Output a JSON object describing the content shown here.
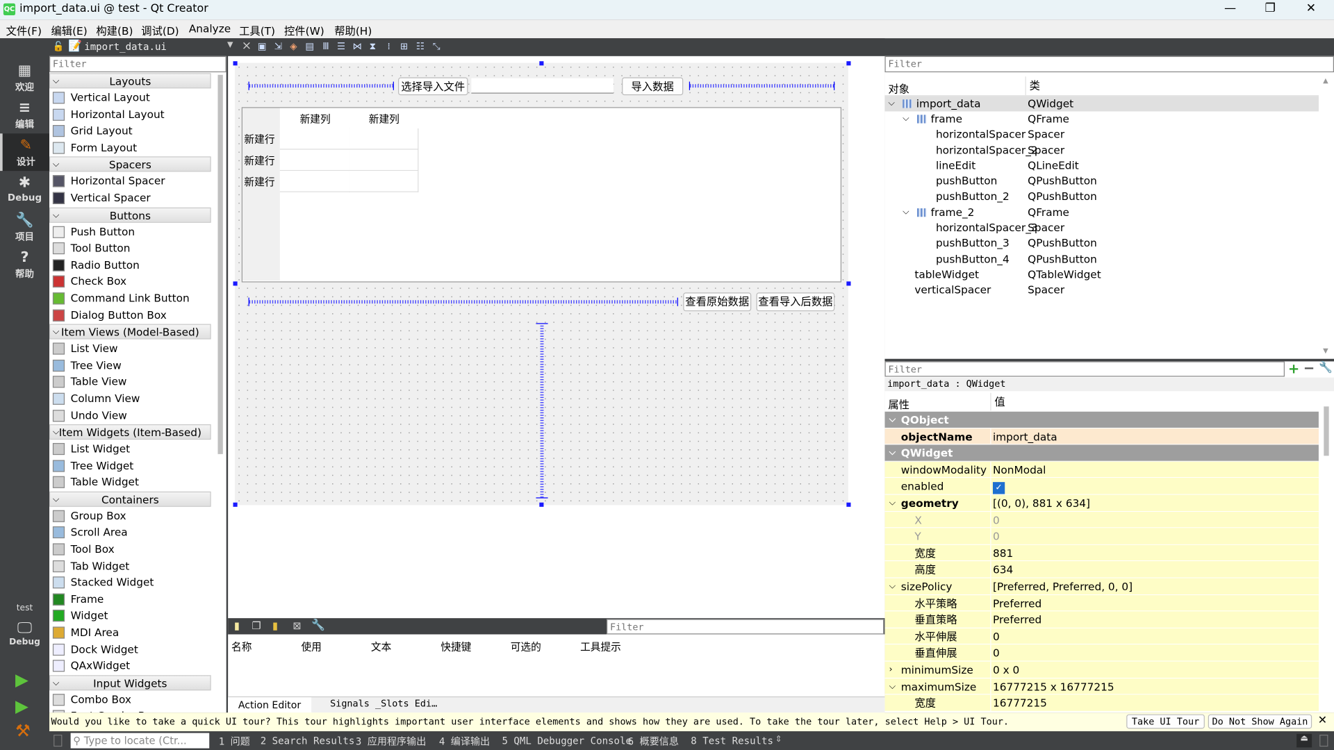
{
  "window": {
    "title": "import_data.ui @ test - Qt Creator",
    "logo": "QC",
    "minimize": "—",
    "maximize": "❐",
    "close": "✕"
  },
  "menu": [
    "文件(F)",
    "编辑(E)",
    "构建(B)",
    "调试(D)",
    "Analyze",
    "工具(T)",
    "控件(W)",
    "帮助(H)"
  ],
  "modes": [
    {
      "label": "欢迎",
      "icon": "grid-icon",
      "glyph": "▦"
    },
    {
      "label": "编辑",
      "icon": "document-icon",
      "glyph": "≡"
    },
    {
      "label": "设计",
      "icon": "pencil-icon",
      "glyph": "✎",
      "active": true
    },
    {
      "label": "Debug",
      "icon": "bug-icon",
      "glyph": "✱"
    },
    {
      "label": "项目",
      "icon": "wrench-icon",
      "glyph": "🔧"
    },
    {
      "label": "帮助",
      "icon": "help-icon",
      "glyph": "?"
    }
  ],
  "kit": {
    "project": "test",
    "mode": "Debug"
  },
  "editor": {
    "file": "import_data.ui",
    "close": "×"
  },
  "widgetbox": {
    "filter_placeholder": "Filter",
    "groups": [
      {
        "name": "Layouts",
        "items": [
          "Vertical Layout",
          "Horizontal Layout",
          "Grid Layout",
          "Form Layout"
        ]
      },
      {
        "name": "Spacers",
        "items": [
          "Horizontal Spacer",
          "Vertical Spacer"
        ]
      },
      {
        "name": "Buttons",
        "items": [
          "Push Button",
          "Tool Button",
          "Radio Button",
          "Check Box",
          "Command Link Button",
          "Dialog Button Box"
        ]
      },
      {
        "name": "Item Views (Model-Based)",
        "items": [
          "List View",
          "Tree View",
          "Table View",
          "Column View",
          "Undo View"
        ]
      },
      {
        "name": "Item Widgets (Item-Based)",
        "items": [
          "List Widget",
          "Tree Widget",
          "Table Widget"
        ]
      },
      {
        "name": "Containers",
        "items": [
          "Group Box",
          "Scroll Area",
          "Tool Box",
          "Tab Widget",
          "Stacked Widget",
          "Frame",
          "Widget",
          "MDI Area",
          "Dock Widget",
          "QAxWidget"
        ]
      },
      {
        "name": "Input Widgets",
        "items": [
          "Combo Box",
          "Font Combo Box"
        ]
      }
    ]
  },
  "form": {
    "select_file_button": "选择导入文件",
    "path_input": "",
    "import_button": "导入数据",
    "table": {
      "columns": [
        "新建列",
        "新建列"
      ],
      "rows": [
        "新建行",
        "新建行",
        "新建行"
      ]
    },
    "view_raw_button": "查看原始数据",
    "view_imported_button": "查看导入后数据"
  },
  "action_editor": {
    "filter_placeholder": "Filter",
    "columns": [
      "名称",
      "使用",
      "文本",
      "快捷键",
      "可选的",
      "工具提示"
    ],
    "tabs": [
      "Action Editor",
      "Signals _Slots Edi…"
    ]
  },
  "object_inspector": {
    "filter_placeholder": "Filter",
    "headers": [
      "对象",
      "类"
    ],
    "rows": [
      {
        "name": "import_data",
        "class": "QWidget",
        "level": 0,
        "expanded": true,
        "selected": true
      },
      {
        "name": "frame",
        "class": "QFrame",
        "level": 1,
        "expanded": true
      },
      {
        "name": "horizontalSpacer",
        "class": "Spacer",
        "level": 2
      },
      {
        "name": "horizontalSpacer_2",
        "class": "Spacer",
        "level": 2
      },
      {
        "name": "lineEdit",
        "class": "QLineEdit",
        "level": 2
      },
      {
        "name": "pushButton",
        "class": "QPushButton",
        "level": 2
      },
      {
        "name": "pushButton_2",
        "class": "QPushButton",
        "level": 2
      },
      {
        "name": "frame_2",
        "class": "QFrame",
        "level": 1,
        "expanded": true
      },
      {
        "name": "horizontalSpacer_3",
        "class": "Spacer",
        "level": 2
      },
      {
        "name": "pushButton_3",
        "class": "QPushButton",
        "level": 2
      },
      {
        "name": "pushButton_4",
        "class": "QPushButton",
        "level": 2
      },
      {
        "name": "tableWidget",
        "class": "QTableWidget",
        "level": 1
      },
      {
        "name": "verticalSpacer",
        "class": "Spacer",
        "level": 1
      }
    ]
  },
  "property_editor": {
    "filter_placeholder": "Filter",
    "context": "import_data : QWidget",
    "headers": [
      "属性",
      "值"
    ],
    "rows": [
      {
        "name": "QObject",
        "type": "group"
      },
      {
        "name": "objectName",
        "value": "import_data",
        "bold": true,
        "bg": "#fde9cf"
      },
      {
        "name": "QWidget",
        "type": "group"
      },
      {
        "name": "windowModality",
        "value": "NonModal",
        "bg": "#fefdc6"
      },
      {
        "name": "enabled",
        "value": "",
        "checkbox": true,
        "checked": true,
        "bg": "#fefdc6"
      },
      {
        "name": "geometry",
        "value": "[(0, 0), 881 x 634]",
        "bold": true,
        "expander": "expanded",
        "bg": "#fefdc6"
      },
      {
        "name": "X",
        "value": "0",
        "sub": true,
        "disabled": true,
        "bg": "#fefdc6"
      },
      {
        "name": "Y",
        "value": "0",
        "sub": true,
        "disabled": true,
        "bg": "#fefdc6"
      },
      {
        "name": "宽度",
        "value": "881",
        "sub": true,
        "bg": "#fefdc6"
      },
      {
        "name": "高度",
        "value": "634",
        "sub": true,
        "bg": "#fefdc6"
      },
      {
        "name": "sizePolicy",
        "value": "[Preferred, Preferred, 0, 0]",
        "expander": "expanded",
        "bg": "#fefdc6"
      },
      {
        "name": "水平策略",
        "value": "Preferred",
        "sub": true,
        "bg": "#fefdc6"
      },
      {
        "name": "垂直策略",
        "value": "Preferred",
        "sub": true,
        "bg": "#fefdc6"
      },
      {
        "name": "水平伸展",
        "value": "0",
        "sub": true,
        "bg": "#fefdc6"
      },
      {
        "name": "垂直伸展",
        "value": "0",
        "sub": true,
        "bg": "#fefdc6"
      },
      {
        "name": "minimumSize",
        "value": "0 x 0",
        "expander": "collapsed",
        "bg": "#fefdc6"
      },
      {
        "name": "maximumSize",
        "value": "16777215 x 16777215",
        "expander": "expanded",
        "bg": "#fefdc6"
      },
      {
        "name": "宽度",
        "value": "16777215",
        "sub": true,
        "bg": "#fefdc6"
      }
    ]
  },
  "tour": {
    "message": "Would you like to take a quick UI tour? This tour highlights important user interface elements and shows how they are used. To take the tour later, select Help > UI Tour.",
    "take": "Take UI Tour",
    "dismiss": "Do Not Show Again",
    "close": "✕"
  },
  "statusbar": {
    "locate_placeholder": "Type to locate (Ctr...",
    "panes": [
      "1 问题",
      "2 Search Results",
      "3 应用程序输出",
      "4 编译输出",
      "5 QML Debugger Console",
      "6 概要信息",
      "8 Test Results"
    ]
  },
  "colors": {
    "accent": "#d96f0c",
    "selection_handle": "#1a1aff",
    "dark": "#404244",
    "tour_bg": "#ffffe1"
  }
}
